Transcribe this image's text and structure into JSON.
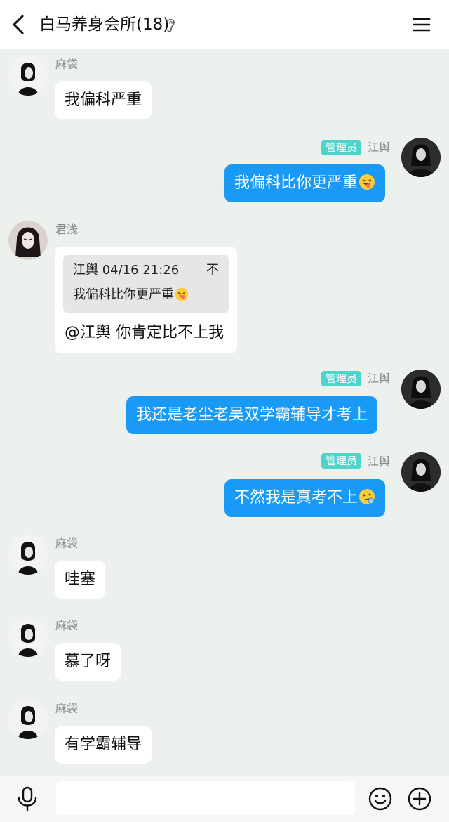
{
  "header": {
    "back_icon": "chevron-left-icon",
    "title": "白马养身会所(18)",
    "ear_icon": "ear-icon",
    "menu_icon": "hamburger-menu-icon"
  },
  "messages": [
    {
      "sender": "麻袋",
      "side": "left",
      "text": "我偏科严重"
    },
    {
      "sender": "江舆",
      "side": "right",
      "tag": "管理员",
      "text": "我偏科比你更严重",
      "emoji": "squinting-tongue-emoji"
    },
    {
      "sender": "君浅",
      "side": "left",
      "quote": {
        "meta": "江舆 04/16 21:26",
        "pin_icon": "不",
        "text": "我偏科比你更严重"
      },
      "text": "@江舆 你肯定比不上我"
    },
    {
      "sender": "江舆",
      "side": "right",
      "tag": "管理员",
      "text": "我还是老尘老吴双学霸辅导才考上"
    },
    {
      "sender": "江舆",
      "side": "right",
      "tag": "管理员",
      "text": "不然我是真考不上",
      "emoji": "thinking-face-emoji"
    },
    {
      "sender": "麻袋",
      "side": "left",
      "text": "哇塞"
    },
    {
      "sender": "麻袋",
      "side": "left",
      "text": "慕了呀"
    },
    {
      "sender": "麻袋",
      "side": "left",
      "text": "有学霸辅导"
    }
  ],
  "composer": {
    "mic_icon": "microphone-icon",
    "input_value": "",
    "emoji_icon": "smiley-icon",
    "plus_icon": "plus-circle-icon"
  },
  "colors": {
    "chat_background": "#edf1ee",
    "outgoing_bubble": "#1a9af7",
    "incoming_bubble": "#ffffff",
    "admin_tag": "#4fd3cb"
  }
}
